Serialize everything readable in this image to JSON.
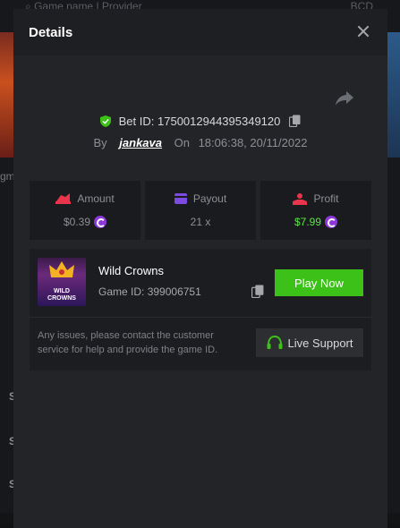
{
  "background": {
    "search_placeholder": "Game name | Provider",
    "currency": "BCD",
    "left_text": "gm",
    "row_marker": "S"
  },
  "modal": {
    "title": "Details",
    "bet_id_label": "Bet ID:",
    "bet_id": "1750012944395349120",
    "by_label": "By",
    "username": "jankava",
    "on_label": "On",
    "datetime": "18:06:38, 20/11/2022",
    "stats": {
      "amount_label": "Amount",
      "amount_value": "$0.39",
      "payout_label": "Payout",
      "payout_value": "21 x",
      "profit_label": "Profit",
      "profit_value": "$7.99"
    },
    "game": {
      "name": "Wild Crowns",
      "id_label": "Game ID:",
      "id": "399006751",
      "thumb_text_1": "WILD",
      "thumb_text_2": "CROWNS",
      "play_label": "Play Now"
    },
    "help_text": "Any issues, please contact the customer service for help and provide the game ID.",
    "support_label": "Live Support"
  },
  "colors": {
    "accent_green": "#3bc117",
    "profit_green": "#5ee24b",
    "coin_purple": "#8e38d8",
    "amount_red": "#e8354b",
    "payout_purple": "#7c4ce0"
  },
  "icons": [
    "search-icon",
    "shield-check-icon",
    "copy-icon",
    "share-icon",
    "close-icon",
    "amount-icon",
    "payout-icon",
    "profit-icon",
    "coin-icon",
    "headset-icon"
  ]
}
